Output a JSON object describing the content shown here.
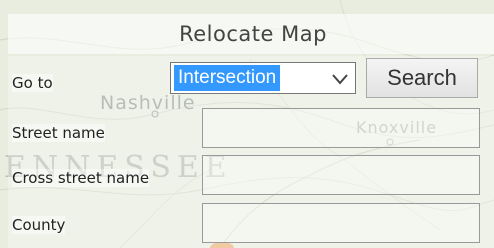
{
  "panel": {
    "title": "Relocate Map"
  },
  "map": {
    "labels": {
      "nashville": "Nashville",
      "knoxville": "Knoxville",
      "state": "ENNESSEE"
    }
  },
  "form": {
    "goto_label": "Go to",
    "goto_selected": "Intersection",
    "search_label": "Search",
    "street_label": "Street name",
    "street_value": "",
    "cross_label": "Cross street name",
    "cross_value": "",
    "county_label": "County",
    "county_value": ""
  },
  "colors": {
    "select_highlight": "#3399ff",
    "map_background": "#e8ede0"
  }
}
